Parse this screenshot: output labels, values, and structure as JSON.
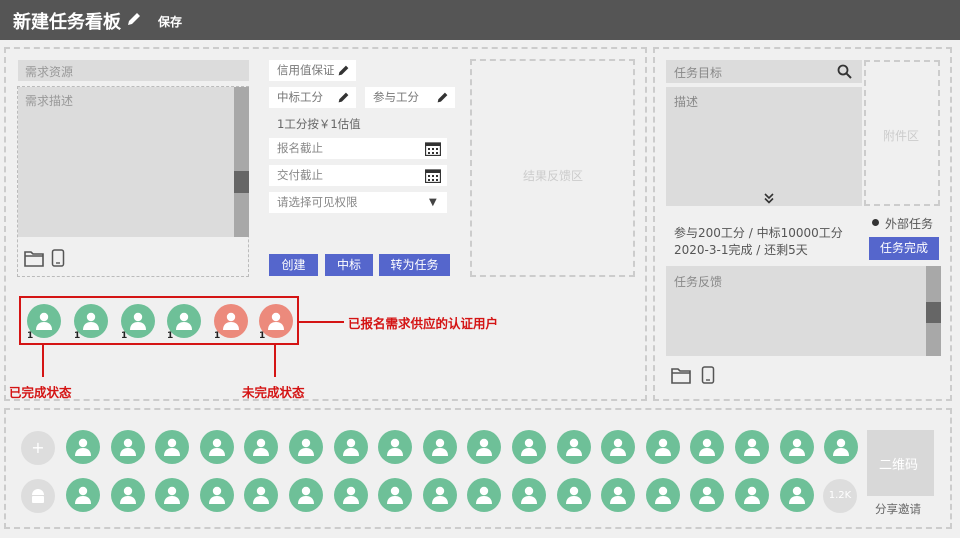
{
  "header": {
    "title": "新建任务看板",
    "save_label": "保存"
  },
  "left": {
    "resource_placeholder": "需求资源",
    "desc_placeholder": "需求描述",
    "credit_label": "信用值保证",
    "win_points_label": "中标工分",
    "join_points_label": "参与工分",
    "rate_text": "1工分按￥1估值",
    "signup_deadline": "报名截止",
    "delivery_deadline": "交付截止",
    "visibility_select": "请选择可见权限",
    "buttons": {
      "create": "创建",
      "win": "中标",
      "to_task": "转为任务"
    },
    "feedback_area": "结果反馈区",
    "avatar_badges": [
      "1",
      "1",
      "1",
      "1",
      "1",
      "1"
    ],
    "annotation_users": "已报名需求供应的认证用户",
    "annotation_done": "已完成状态",
    "annotation_undone": "未完成状态"
  },
  "right": {
    "goal_placeholder": "任务目标",
    "desc_placeholder": "描述",
    "attachment_area": "附件区",
    "external_task": "外部任务",
    "points_info": "参与200工分 / 中标10000工分",
    "date_info": "2020-3-1完成 / 还剩5天",
    "complete_button": "任务完成",
    "feedback_placeholder": "任务反馈"
  },
  "bottom": {
    "add_symbol": "+",
    "more_count": "1.2K",
    "qr_label": "二维码",
    "share_label": "分享邀请"
  },
  "colors": {
    "topbar": "#555555",
    "accent_blue": "#5566cc",
    "avatar_green": "#6ec098",
    "avatar_red": "#ec8a7c",
    "annotation_red": "#d41414"
  },
  "icons": [
    "pencil-icon",
    "search-icon",
    "folder-icon",
    "phone-icon",
    "calendar-icon",
    "chevron-down-icon",
    "android-icon",
    "user-icon"
  ]
}
